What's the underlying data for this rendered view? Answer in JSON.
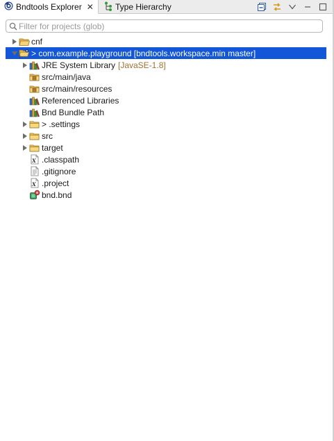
{
  "tabs": {
    "explorer_label": "Bndtools Explorer",
    "hierarchy_label": "Type Hierarchy",
    "close_glyph": "✕"
  },
  "filter": {
    "placeholder": "Filter for projects (glob)",
    "value": ""
  },
  "tree": [
    {
      "label": "cnf",
      "decoration": "",
      "icon": "folder-open-icon",
      "expander": "collapsed",
      "depth": 0,
      "selected": false
    },
    {
      "label": "> com.example.playground [bndtools.workspace.min master]",
      "decoration": "",
      "icon": "project-icon",
      "expander": "expanded",
      "depth": 0,
      "selected": true
    },
    {
      "label": "JRE System Library",
      "decoration": "[JavaSE-1.8]",
      "icon": "library-icon",
      "expander": "collapsed",
      "depth": 1,
      "selected": false
    },
    {
      "label": "src/main/java",
      "decoration": "",
      "icon": "package-folder-icon",
      "expander": "none",
      "depth": 1,
      "selected": false
    },
    {
      "label": "src/main/resources",
      "decoration": "",
      "icon": "package-folder-icon",
      "expander": "none",
      "depth": 1,
      "selected": false
    },
    {
      "label": "Referenced Libraries",
      "decoration": "",
      "icon": "library-icon",
      "expander": "none",
      "depth": 1,
      "selected": false
    },
    {
      "label": "Bnd Bundle Path",
      "decoration": "",
      "icon": "library-icon",
      "expander": "none",
      "depth": 1,
      "selected": false
    },
    {
      "label": "> .settings",
      "decoration": "",
      "icon": "folder-icon",
      "expander": "collapsed",
      "depth": 1,
      "selected": false
    },
    {
      "label": "src",
      "decoration": "",
      "icon": "folder-icon",
      "expander": "collapsed",
      "depth": 1,
      "selected": false
    },
    {
      "label": "target",
      "decoration": "",
      "icon": "folder-icon",
      "expander": "collapsed",
      "depth": 1,
      "selected": false
    },
    {
      "label": ".classpath",
      "decoration": "",
      "icon": "xml-file-icon",
      "expander": "none",
      "depth": 1,
      "selected": false
    },
    {
      "label": ".gitignore",
      "decoration": "",
      "icon": "text-file-icon",
      "expander": "none",
      "depth": 1,
      "selected": false
    },
    {
      "label": ".project",
      "decoration": "",
      "icon": "xml-file-icon",
      "expander": "none",
      "depth": 1,
      "selected": false
    },
    {
      "label": "bnd.bnd",
      "decoration": "",
      "icon": "bnd-file-icon",
      "expander": "none",
      "depth": 1,
      "selected": false
    }
  ],
  "colors": {
    "selection": "#1357d8",
    "decoration": "#a2702e",
    "folder": "#e8b84a"
  }
}
